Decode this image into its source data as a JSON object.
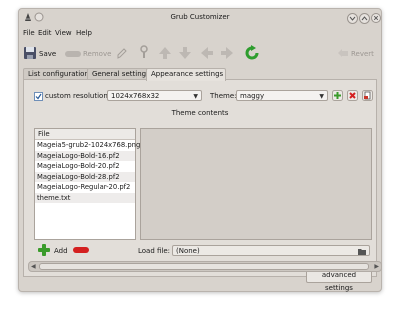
{
  "window": {
    "title": "Grub Customizer"
  },
  "menu": {
    "file": "File",
    "edit": "Edit",
    "view": "View",
    "help": "Help"
  },
  "toolbar": {
    "save": "Save",
    "remove": "Remove",
    "revert": "Revert"
  },
  "tabs": [
    {
      "label": "List configuration"
    },
    {
      "label": "General settings"
    },
    {
      "label": "Appearance settings"
    }
  ],
  "appearance": {
    "custom_resolution_label": "custom resolution:",
    "custom_resolution_checked": true,
    "resolution_value": "1024x768x32",
    "theme_label": "Theme:",
    "theme_value": "maggy",
    "theme_contents_label": "Theme contents",
    "file_header": "File",
    "files": [
      "Mageia5-grub2-1024x768.png",
      "MageiaLogo-Bold-16.pf2",
      "MageiaLogo-Bold-20.pf2",
      "MageiaLogo-Bold-28.pf2",
      "MageiaLogo-Regular-20.pf2",
      "theme.txt"
    ],
    "add_label": "Add",
    "load_file_label": "Load file:",
    "load_file_value": "(None)",
    "advanced_button": "advanced settings"
  },
  "colors": {
    "add_green": "#3a9b2a",
    "remove_red": "#d42020",
    "refresh_green": "#2e9d2e"
  }
}
